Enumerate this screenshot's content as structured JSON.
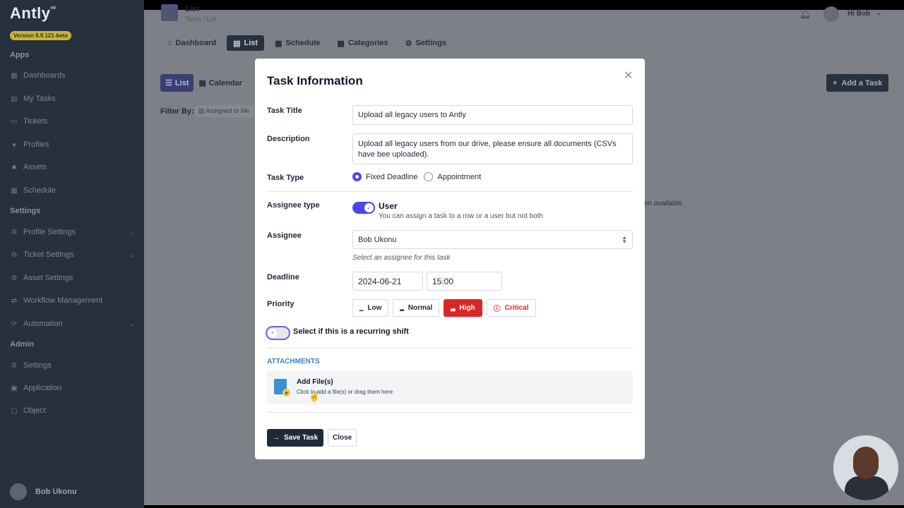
{
  "app": {
    "logo": "Antly",
    "logo_mark": "∞",
    "version": "Version 0.9.121-beta"
  },
  "sidebar": {
    "apps_heading": "Apps",
    "apps": [
      {
        "label": "Dashboards",
        "icon": "grid-icon"
      },
      {
        "label": "My Tasks",
        "icon": "clipboard-icon"
      },
      {
        "label": "Tickets",
        "icon": "ticket-icon"
      },
      {
        "label": "Profiles",
        "icon": "user-icon"
      },
      {
        "label": "Assets",
        "icon": "box-icon"
      },
      {
        "label": "Schedule",
        "icon": "calendar-icon"
      }
    ],
    "settings_heading": "Settings",
    "settings": [
      {
        "label": "Profile Settings",
        "icon": "user-cog-icon",
        "expandable": true
      },
      {
        "label": "Ticket Settings",
        "icon": "ticket-cog-icon",
        "expandable": true
      },
      {
        "label": "Asset Settings",
        "icon": "box-cog-icon",
        "expandable": false
      },
      {
        "label": "Workflow Management",
        "icon": "workflow-icon",
        "expandable": false
      },
      {
        "label": "Automation",
        "icon": "automation-icon",
        "expandable": true
      }
    ],
    "admin_heading": "Admin",
    "admin": [
      {
        "label": "Settings",
        "icon": "gear-icon"
      },
      {
        "label": "Application",
        "icon": "app-icon"
      },
      {
        "label": "Object",
        "icon": "object-icon"
      }
    ],
    "user_name": "Bob Ukonu"
  },
  "topbar": {
    "title": "List",
    "breadcrumb": "Tasks  /  List",
    "greeting": "Hi Bob"
  },
  "tabs": [
    {
      "label": "Dashboard",
      "icon": "⌂",
      "active": false
    },
    {
      "label": "List",
      "icon": "▤",
      "active": true
    },
    {
      "label": "Schedule",
      "icon": "▦",
      "active": false
    },
    {
      "label": "Categories",
      "icon": "▩",
      "active": false
    },
    {
      "label": "Settings",
      "icon": "⚙",
      "active": false
    }
  ],
  "view_toggle": {
    "list": "List",
    "calendar": "Calendar"
  },
  "filter": {
    "label": "Filter By:",
    "chip": "Assigned to Me"
  },
  "add_task_label": "Add a Task",
  "empty_message": "en available.",
  "modal": {
    "title": "Task Information",
    "task_title_label": "Task Title",
    "task_title_value": "Upload all legacy users to Antly",
    "description_label": "Description",
    "description_value": "Upload all legacy users from our drive, please ensure all documents (CSVs have bee uploaded).",
    "task_type_label": "Task Type",
    "task_type_options": [
      "Fixed Deadline",
      "Appointment"
    ],
    "task_type_selected": "Fixed Deadline",
    "assignee_type_label": "Assignee type",
    "assignee_type_value": "User",
    "assignee_type_help": "You can assign a task to a row or a user but not both",
    "assignee_label": "Assignee",
    "assignee_value": "Bob Ukonu",
    "assignee_help": "Select an assignee for this task",
    "deadline_label": "Deadline",
    "deadline_date": "2024-06-21",
    "deadline_time": "15:00",
    "priority_label": "Priority",
    "priorities": [
      {
        "label": "Low",
        "selected": false
      },
      {
        "label": "Normal",
        "selected": false
      },
      {
        "label": "High",
        "selected": true
      },
      {
        "label": "Critical",
        "selected": false
      }
    ],
    "recurring_label": "Select if this is a recurring shift",
    "recurring_enabled": false,
    "attachments_title": "ATTACHMENTS",
    "add_files_title": "Add File(s)",
    "add_files_help": "Click to add a file(s) or drag them here",
    "save_label": "Save Task",
    "close_label": "Close"
  },
  "colors": {
    "accent": "#4f46e5",
    "danger": "#dc2626",
    "sidebar_bg": "#27303d",
    "primary_button": "#1f2937"
  }
}
